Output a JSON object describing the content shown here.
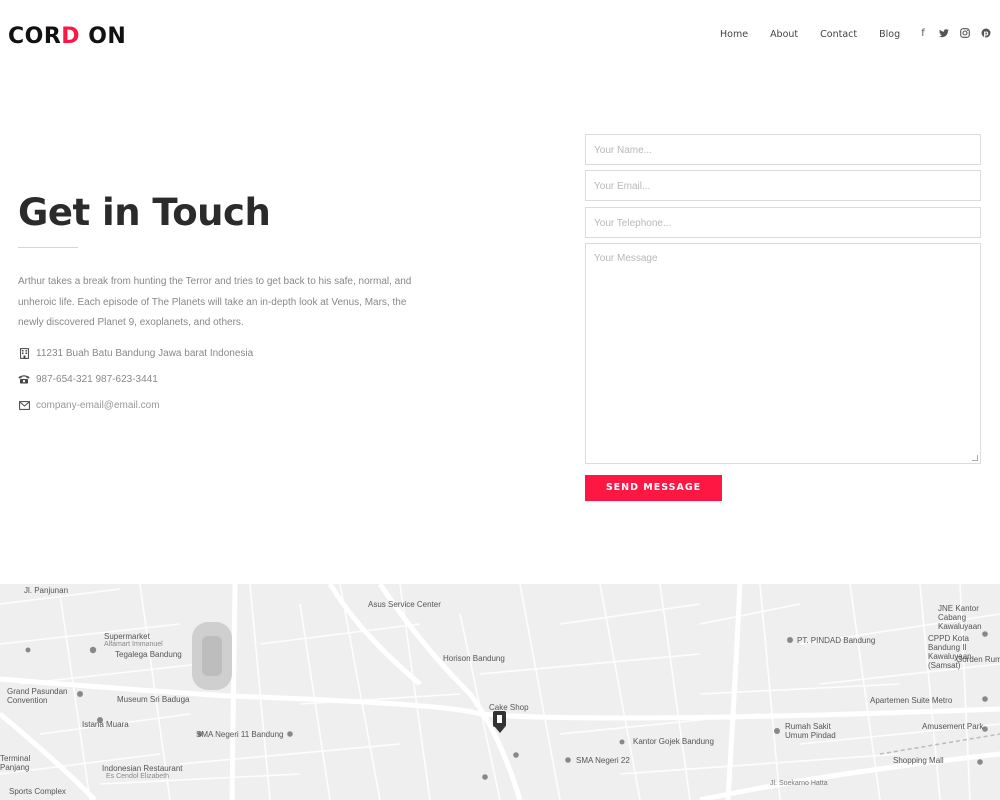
{
  "brand": {
    "logo_a": "COR",
    "logo_accent": "D",
    "logo_b": " ON"
  },
  "nav": {
    "items": [
      "Home",
      "About",
      "Contact",
      "Blog"
    ]
  },
  "social": [
    "facebook-icon",
    "twitter-icon",
    "instagram-icon",
    "pinterest-icon"
  ],
  "contact": {
    "title": "Get in Touch",
    "description": "Arthur takes a break from hunting the Terror and tries to get back to his safe, normal, and unheroic life. Each episode of The Planets will take an in-depth look at Venus, Mars, the newly discovered Planet 9, exoplanets, and others.",
    "address": "11231 Buah Batu Bandung Jawa barat Indonesia",
    "phone": "987-654-321 987-623-3441",
    "email": "company-email@email.com"
  },
  "form": {
    "name_placeholder": "Your Name...",
    "email_placeholder": "Your Email...",
    "telephone_placeholder": "Your Telephone...",
    "message_placeholder": "Your Message",
    "submit_label": "SEND MESSAGE"
  },
  "colors": {
    "accent": "#ff1744",
    "text": "#2b2b2b",
    "muted": "#888888"
  },
  "map": {
    "labels": [
      "Jl. Panjunan",
      "Supermarket",
      "Alfamart Immanuel",
      "Tegalega Bandung",
      "Grand Pasundan Convention",
      "Museum Sri Baduga",
      "Istana Muara",
      "SMA Negeri 11 Bandung",
      "Indonesian Restaurant",
      "Es Cendol Elizabeth",
      "Terminal Panjang",
      "Sports Complex",
      "Asus Service Center",
      "Horison Bandung",
      "Cake Shop",
      "SMA Negeri 22",
      "Kantor Gojek Bandung",
      "PT. PINDAD Bandung",
      "Rumah Sakit Umum Pindad",
      "Apartemen Suite Metro",
      "JNE Kantor Cabang Kawaluyaan",
      "CPPD Kota Bandung II Kawaluyaan (Samsat)",
      "Gorden Rum",
      "Amusement Park",
      "Shopping Mall",
      "Jl. Soekarno Hatta"
    ]
  }
}
